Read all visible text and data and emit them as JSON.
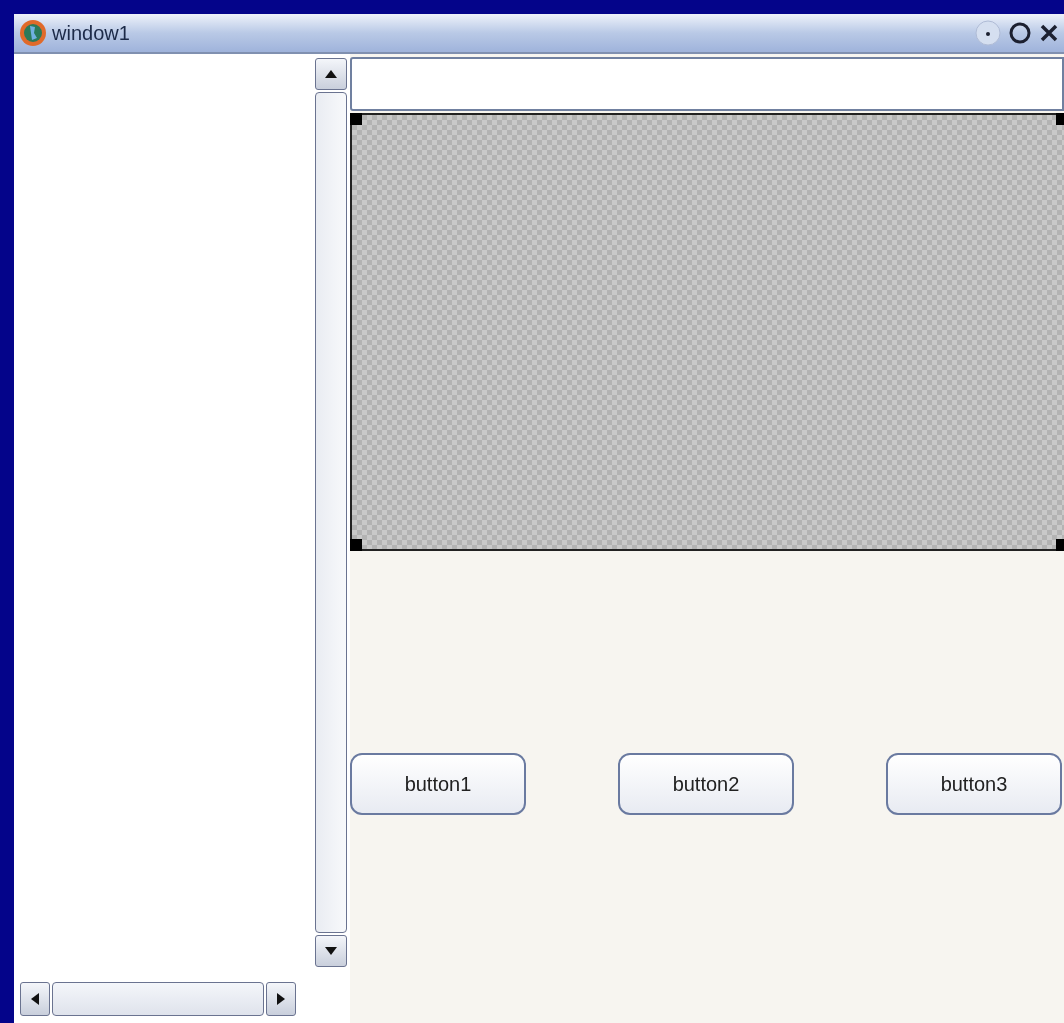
{
  "window": {
    "title": "window1"
  },
  "buttons": [
    {
      "label": "button1"
    },
    {
      "label": "button2"
    },
    {
      "label": "button3"
    }
  ]
}
